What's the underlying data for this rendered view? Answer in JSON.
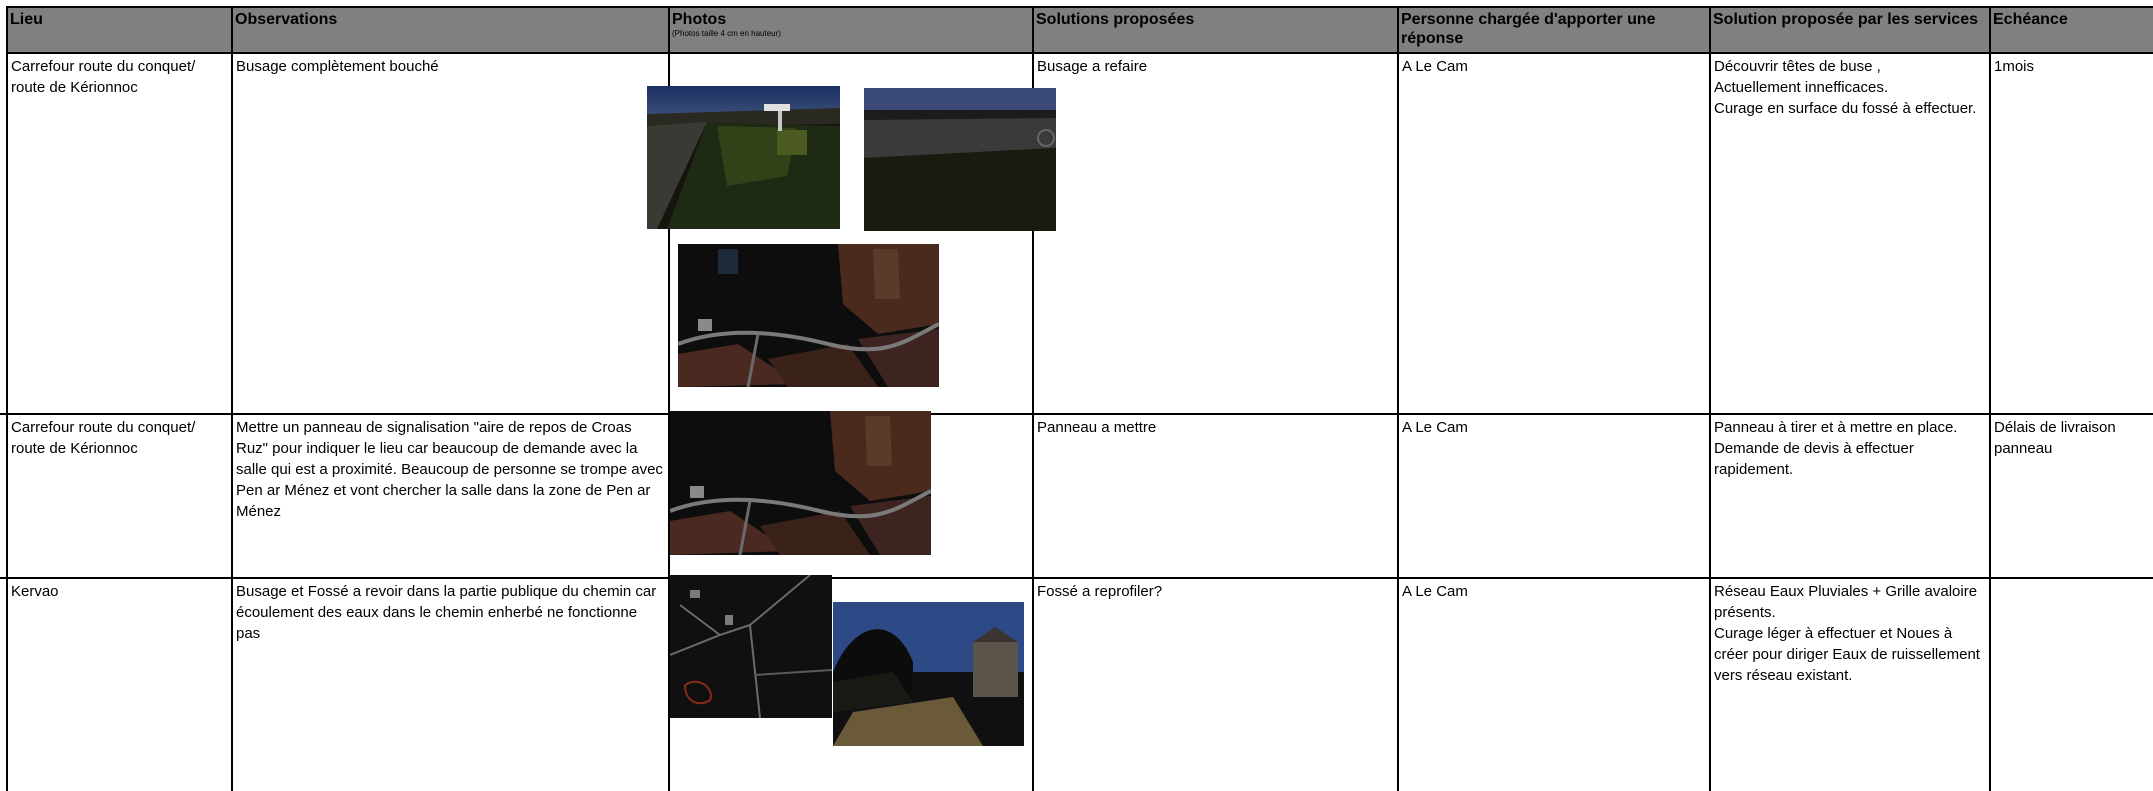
{
  "headers": {
    "lieu": "Lieu",
    "observations": "Observations",
    "photos": "Photos",
    "photos_note": "(Photos taille 4 cm en hauteur)",
    "solutions": "Solutions proposées",
    "personne": "Personne chargée d'apporter une réponse",
    "services": "Solution proposée par les services",
    "echeance": "Echéance"
  },
  "rows": [
    {
      "lieu": "Carrefour route du conquet/ route de Kérionnoc",
      "observations": "Busage complètement bouché",
      "solution": "Busage a refaire",
      "personne": "A Le Cam",
      "services": "Découvrir têtes de buse ,\nActuellement innefficaces.\nCurage en surface du fossé à effectuer.",
      "echeance": "1mois"
    },
    {
      "lieu": "Carrefour route du conquet/ route de Kérionnoc",
      "observations": "Mettre un panneau de signalisation \"aire de repos de Croas Ruz\" pour indiquer le lieu car beaucoup de demande avec la salle qui est a proximité. Beaucoup de personne se trompe avec Pen ar Ménez et vont chercher la salle dans la zone de Pen ar Ménez",
      "solution": "Panneau a mettre",
      "personne": "A Le Cam",
      "services": "Panneau à tirer et à mettre en place.\nDemande de devis à effectuer rapidement.",
      "echeance": "Délais de livraison panneau"
    },
    {
      "lieu": "Kervao",
      "observations": "Busage et Fossé a revoir dans la partie publique du chemin car écoulement des eaux dans le chemin enherbé ne fonctionne pas",
      "solution": "Fossé a reprofiler?",
      "personne": "A Le Cam",
      "services": "Réseau Eaux Pluviales + Grille avaloire présents.\nCurage léger à effectuer et Noues à créer pour diriger Eaux de ruissellement vers réseau existant.",
      "echeance": ""
    }
  ]
}
